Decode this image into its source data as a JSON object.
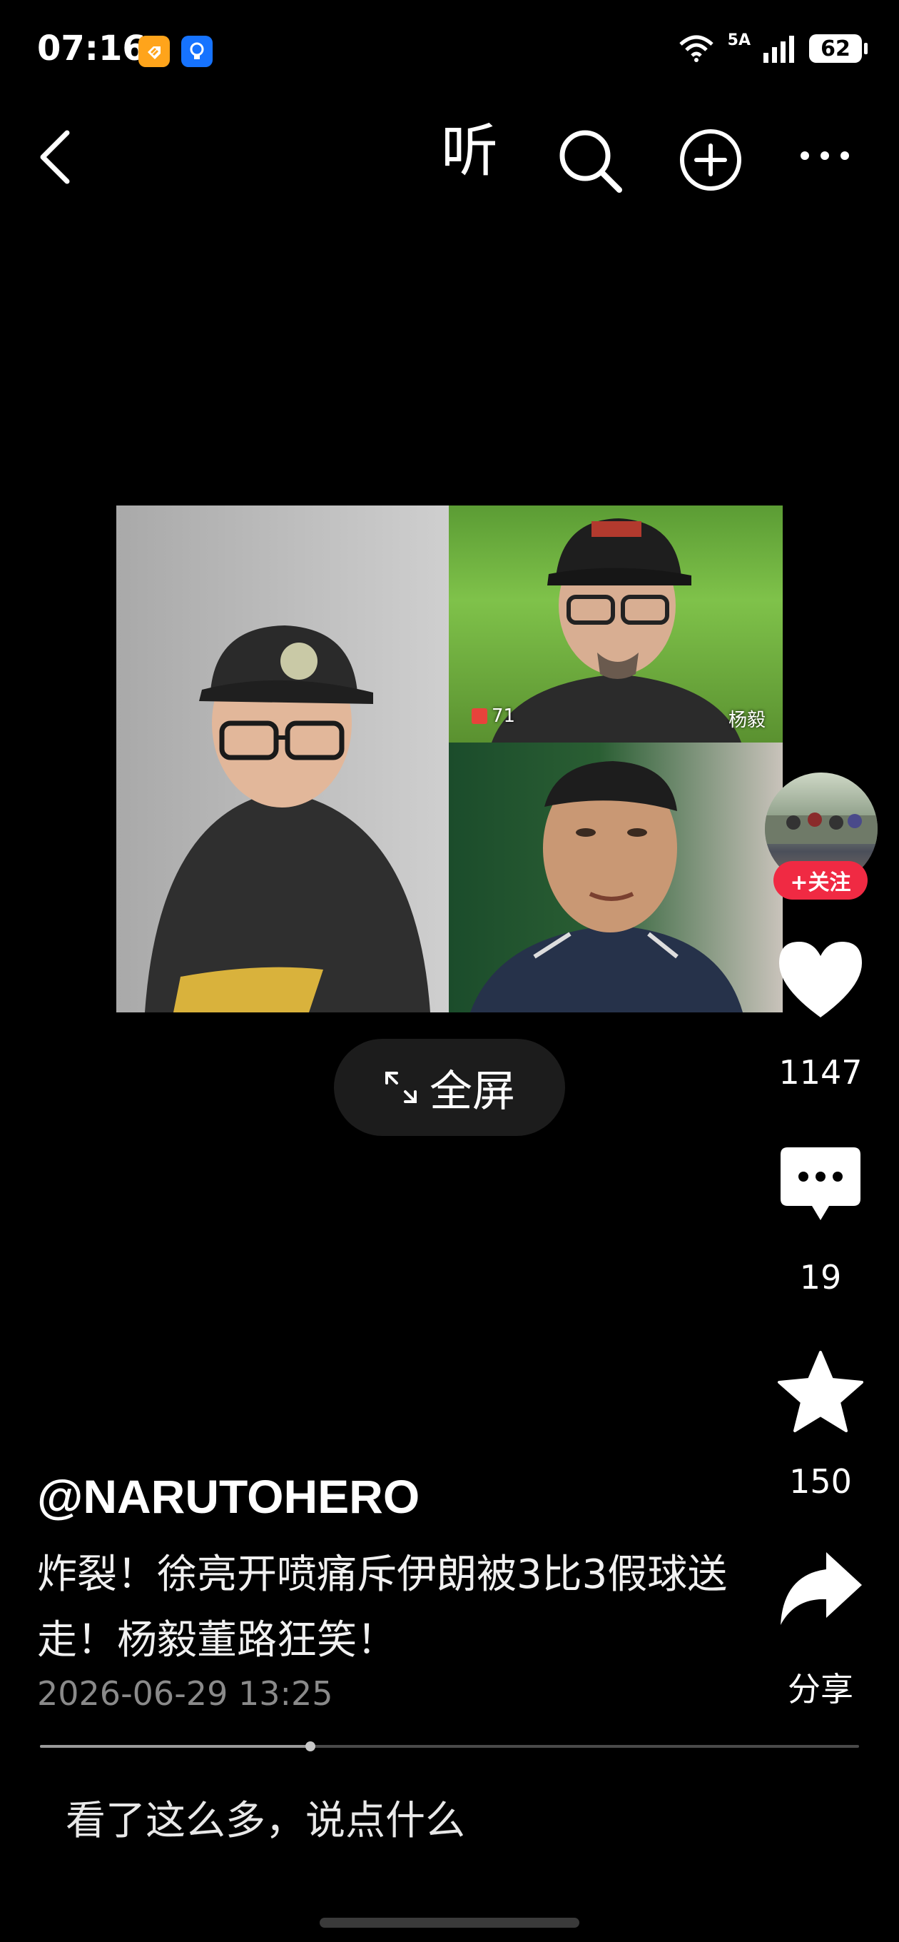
{
  "status_bar": {
    "time": "07:16",
    "network_label": "5A",
    "battery": "62"
  },
  "top_nav": {
    "listen_label": "听"
  },
  "video": {
    "top_right_name": "杨毅",
    "top_right_gift_count": "71",
    "fullscreen_label": "全屏"
  },
  "actions": {
    "follow_label": "+关注",
    "like_count": "1147",
    "comment_count": "19",
    "favorite_count": "150",
    "share_label": "分享"
  },
  "post": {
    "author": "@NARUTOHERO",
    "caption": "炸裂！徐亮开喷痛斥伊朗被3比3假球送走！杨毅董路狂笑！",
    "time": "2026-06-29 13:25",
    "progress": 0.33
  },
  "comment_input": {
    "placeholder": "看了这么多，说点什么"
  },
  "colors": {
    "background": "#000000",
    "follow_red": "#f02a43",
    "muted_text": "#8a8a8a"
  }
}
